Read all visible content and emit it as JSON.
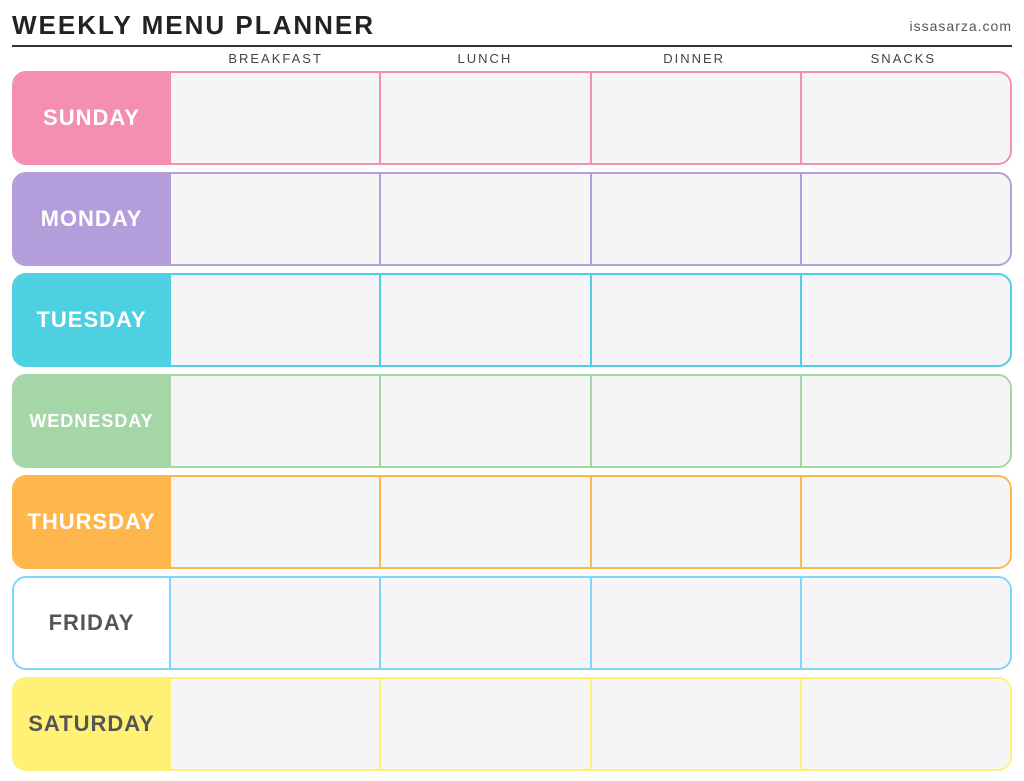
{
  "header": {
    "title": "WEEKLY MENU PLANNER",
    "website": "issasarza.com"
  },
  "columns": {
    "spacer": "",
    "breakfast": "Breakfast",
    "lunch": "Lunch",
    "dinner": "Dinner",
    "snacks": "Snacks"
  },
  "days": [
    {
      "id": "sunday",
      "label": "Sunday",
      "colorClass": "row-sunday",
      "cells": [
        "",
        "",
        "",
        ""
      ]
    },
    {
      "id": "monday",
      "label": "Monday",
      "colorClass": "row-monday",
      "cells": [
        "",
        "",
        "",
        ""
      ]
    },
    {
      "id": "tuesday",
      "label": "Tuesday",
      "colorClass": "row-tuesday",
      "cells": [
        "",
        "",
        "",
        ""
      ]
    },
    {
      "id": "wednesday",
      "label": "Wednesday",
      "colorClass": "row-wednesday",
      "cells": [
        "",
        "",
        "",
        ""
      ]
    },
    {
      "id": "thursday",
      "label": "Thursday",
      "colorClass": "row-thursday",
      "cells": [
        "",
        "",
        "",
        ""
      ]
    },
    {
      "id": "friday",
      "label": "Friday",
      "colorClass": "row-friday",
      "cells": [
        "",
        "",
        "",
        ""
      ]
    },
    {
      "id": "saturday",
      "label": "Saturday",
      "colorClass": "row-saturday",
      "cells": [
        "",
        "",
        "",
        ""
      ]
    }
  ]
}
